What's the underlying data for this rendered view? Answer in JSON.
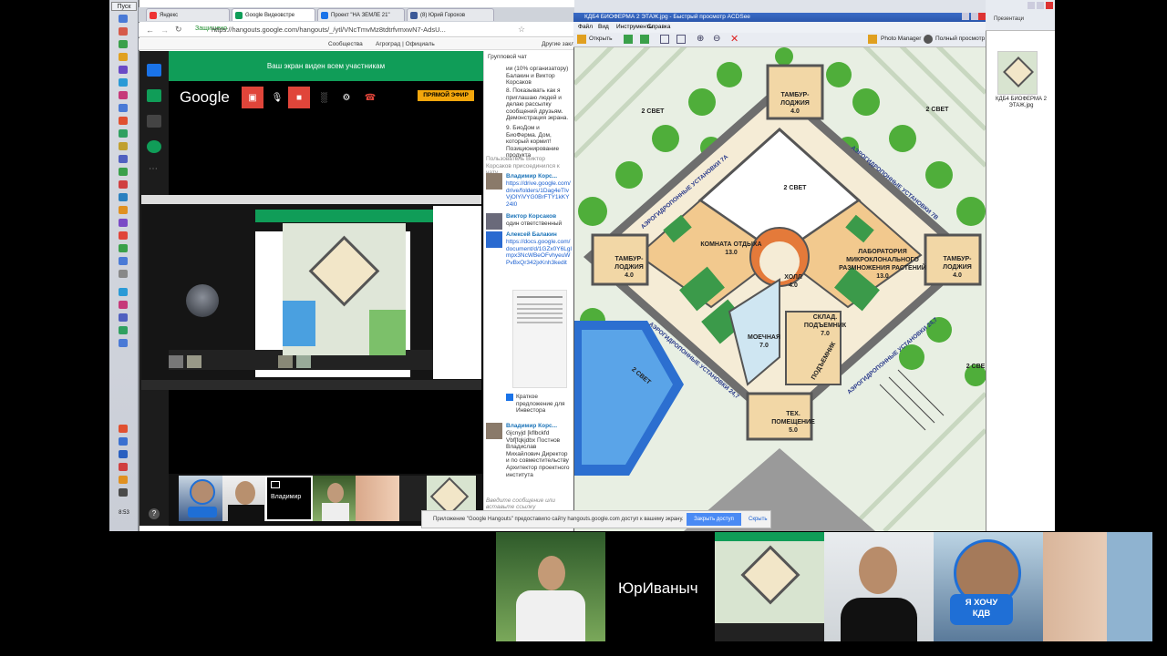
{
  "taskbar": {
    "start_label": "Пуск",
    "clock": "8:53"
  },
  "browser": {
    "tabs": [
      {
        "label": "Яндекс",
        "color": "#e33"
      },
      {
        "label": "Google Видеовстре",
        "color": "#109d58"
      },
      {
        "label": "Проект \"НА ЗЕМЛЕ 21\"",
        "color": "#1a73e8"
      },
      {
        "label": "(8) Юрий Горохов",
        "color": "#3b5998"
      }
    ],
    "url": "https://hangouts.google.com/hangouts/_/ytl/VNcTmvMz8tdtrfvmxwN7-AdsU...",
    "secure_label": "Защищено",
    "bookmarks": [
      "Сообщества",
      "Агроград | Официаль",
      "Другие закладки"
    ]
  },
  "hangout": {
    "share_banner": "Ваш экран виден всем участникам",
    "logo": "Google",
    "live_button": "ПРЯМОЙ ЭФИР",
    "me_label": "Владимир",
    "help": "?"
  },
  "chat": {
    "title": "Групповой чат",
    "messages": [
      {
        "text": "ии (10% организатору) Балакин и Виктор Корсаков"
      },
      {
        "text": "8. Показывать как я приглашаю людей и делаю рассылку сообщений друзьям. Демонстрация экрана."
      },
      {
        "text": "9. БиоДом и БиоФерма. Дом, который кормит! Позиционирование продукта"
      },
      {
        "text": "Пользователь Виктор Корсаков присоединился к чату."
      },
      {
        "name": "Владимир Корс...",
        "link": "https://drive.google.com/drive/folders/1Dag4eTIvVjOlYiVYG0BrFTY1kKY24l0"
      },
      {
        "name": "Виктор Корсаков",
        "text": "один ответственный"
      },
      {
        "name": "Алексей Балакин",
        "link": "https://docs.google.com/document/d/1GZx0Y6Lglmpx3NcWBeOFvhyeuWPvBxQr342jxKnh3kedit"
      },
      {
        "text": "Краткое предложение для Инвестора"
      },
      {
        "name": "Владимир Корс...",
        "text": "Gjcnyjd [kflbckfd Vbf[fqkjdbx Постнов Владислав Михайлович Директор и по совместительству Архитектор проектного института"
      }
    ],
    "input_placeholder": "Введите сообщение или вставьте ссылку"
  },
  "viewer": {
    "title": "КДБ4 БИОФЕРМА 2 ЭТАЖ.jpg - Быстрый просмотр ACDSee",
    "menu": [
      "Файл",
      "Вид",
      "Инструменты",
      "Справка"
    ],
    "tools": {
      "open": "Открыть",
      "photo_manager": "Photo Manager",
      "full_view": "Полный просмотр"
    },
    "plan_labels": {
      "tambur_top": "ТАМБУР-\nЛОДЖИЯ\n4.0",
      "two_svet_center": "2 СВЕТ",
      "two_svet_tl": "2 СВЕТ",
      "two_svet_tr": "2 СВЕТ",
      "two_svet_bl": "2 СВЕТ",
      "two_svet_br": "2 СВЕ",
      "room_rest": "КОМНАТА ОТДЫХА\n13.0",
      "lab": "ЛАБОРАТОРИЯ\nМИКРОКЛОНАЛЬНОГО\nРАЗМНОЖЕНИЯ РАСТЕНИЙ\n13.0",
      "tambur_left": "ТАМБУР-\nЛОДЖИЯ\n4.0",
      "tambur_right": "ТАМБУР-\nЛОДЖИЯ\n4.0",
      "hall": "ХОЛЛ\n4.0",
      "wash": "МОЕЧНАЯ\n7.0",
      "storage": "СКЛАД.\nПОДЪЕМНИК\n7.0",
      "lift": "ПОДЪЕМНИК",
      "tech": "ТЕХ.\nПОМЕЩЕНИЕ\n5.0",
      "aero_tl": "АЭРОГИДРОПОННЫЕ УСТАНОВКИ 7А",
      "aero_tr": "АЭРОГИДРОПОННЫЕ УСТАНОВКИ 7В",
      "aero_bl": "АЭРОГИДРОПОННЫЕ УСТАНОВКИ 24,7",
      "aero_br": "АЭРОГИДРОПОННЫЕ УСТАНОВКИ 24,7"
    }
  },
  "explorer": {
    "top_label": "Презентаци",
    "file_name": "КДБ4 БИОФЕРМА 2 ЭТАЖ.jpg"
  },
  "notification": {
    "text": "Приложение \"Google Hangouts\" предоставило сайту hangouts.google.com доступ к вашему экрану.",
    "share": "Закрыть доступ",
    "hide": "Скрыть"
  },
  "bottom_strip": {
    "name": "ЮрИваныч",
    "badge_line1": "Я ХОЧУ",
    "badge_line2": "КДВ"
  }
}
